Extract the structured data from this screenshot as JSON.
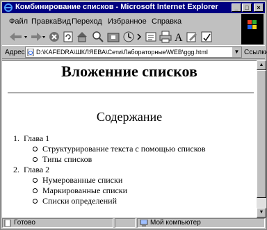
{
  "window": {
    "title": "Комбинирование списков - Microsoft Internet Explorer"
  },
  "menu": [
    "Файл",
    "Правка",
    "Вид",
    "Переход",
    "Избранное",
    "Справка"
  ],
  "address": {
    "label": "Адрес",
    "value": "D:\\KAFEDRA\\ШКЛЯЕВА\\Сети\\Лабораторные\\WEB\\ggg.html",
    "links_label": "Ссылки"
  },
  "page": {
    "title": "Вложенние списков",
    "subtitle": "Содержание",
    "chapters": [
      {
        "label": "Глава 1",
        "items": [
          "Структурирование текста с помощью списков",
          "Типы списков"
        ]
      },
      {
        "label": "Глава 2",
        "items": [
          "Нумерованные списки",
          "Маркированные списки",
          "Списки определений"
        ]
      }
    ]
  },
  "status": {
    "text": "Готово",
    "zone": "Мой компьютер"
  }
}
